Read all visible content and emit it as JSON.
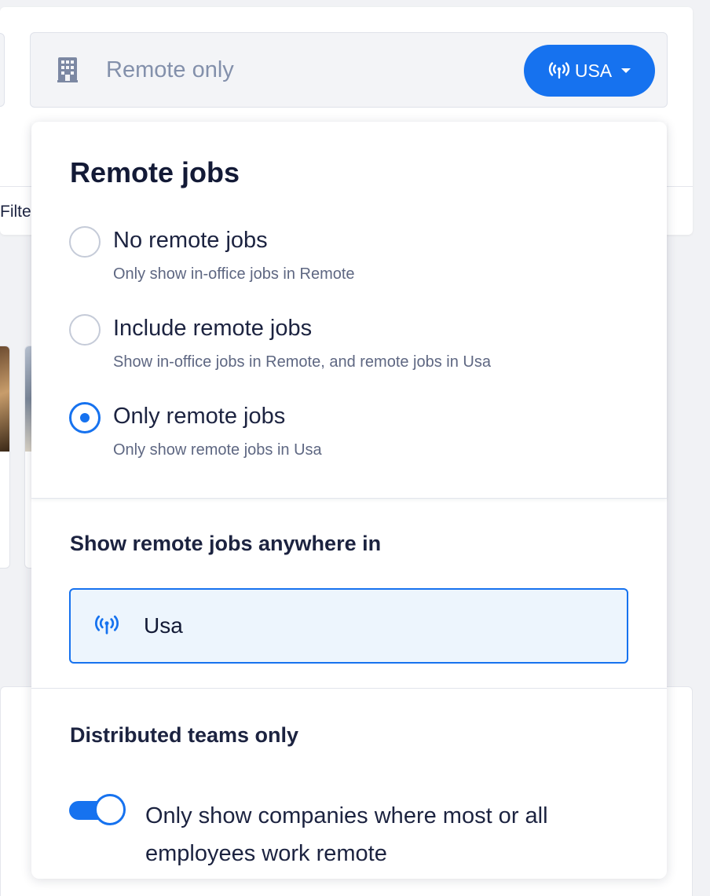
{
  "background": {
    "filter_text": "Filte"
  },
  "location_field": {
    "value": "Remote only",
    "country_button_label": "USA"
  },
  "dropdown": {
    "title": "Remote jobs",
    "options": [
      {
        "label": "No remote jobs",
        "description": "Only show in-office jobs in Remote",
        "selected": false
      },
      {
        "label": "Include remote jobs",
        "description": "Show in-office jobs in Remote, and remote jobs in Usa",
        "selected": false
      },
      {
        "label": "Only remote jobs",
        "description": "Only show remote jobs in Usa",
        "selected": true
      }
    ],
    "anywhere_heading": "Show remote jobs anywhere in",
    "region": "Usa",
    "teams_heading": "Distributed teams only",
    "teams_toggle": {
      "on": true,
      "label": "Only show companies where most or all employees work remote"
    }
  },
  "colors": {
    "accent": "#1672ef",
    "text": "#1c2340",
    "muted": "#5e6782",
    "placeholder": "#8390ab"
  }
}
